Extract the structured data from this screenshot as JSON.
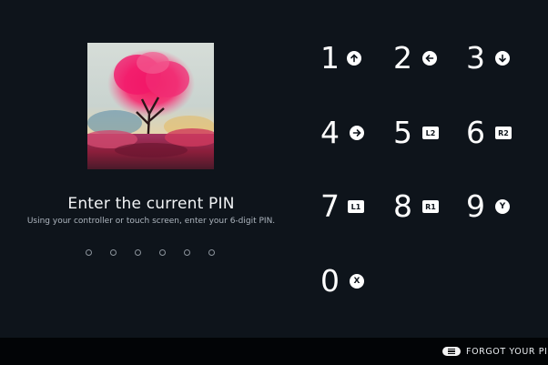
{
  "prompt": {
    "title": "Enter the current PIN",
    "subtitle": "Using your controller or touch screen, enter your 6-digit PIN.",
    "pin_slots": 6
  },
  "keypad": [
    {
      "digit": "1",
      "button_hint": "",
      "hint_icon": "dpad-up-icon"
    },
    {
      "digit": "2",
      "button_hint": "",
      "hint_icon": "dpad-left-icon"
    },
    {
      "digit": "3",
      "button_hint": "",
      "hint_icon": "dpad-down-icon"
    },
    {
      "digit": "4",
      "button_hint": "",
      "hint_icon": "dpad-right-icon"
    },
    {
      "digit": "5",
      "button_hint": "L2",
      "hint_icon": "l2-button-icon"
    },
    {
      "digit": "6",
      "button_hint": "R2",
      "hint_icon": "r2-button-icon"
    },
    {
      "digit": "7",
      "button_hint": "L1",
      "hint_icon": "l1-button-icon"
    },
    {
      "digit": "8",
      "button_hint": "R1",
      "hint_icon": "r1-button-icon"
    },
    {
      "digit": "9",
      "button_hint": "Y",
      "hint_icon": "y-button-icon"
    },
    {
      "digit": "0",
      "button_hint": "X",
      "hint_icon": "x-button-icon"
    }
  ],
  "footer": {
    "forgot_label": "FORGOT YOUR PIN?",
    "menu_icon": "menu-button-icon"
  },
  "colors": {
    "background": "#0e141b",
    "footer_bar": "#020406",
    "text": "#ffffff",
    "subtle_text": "#aeb6bf"
  }
}
